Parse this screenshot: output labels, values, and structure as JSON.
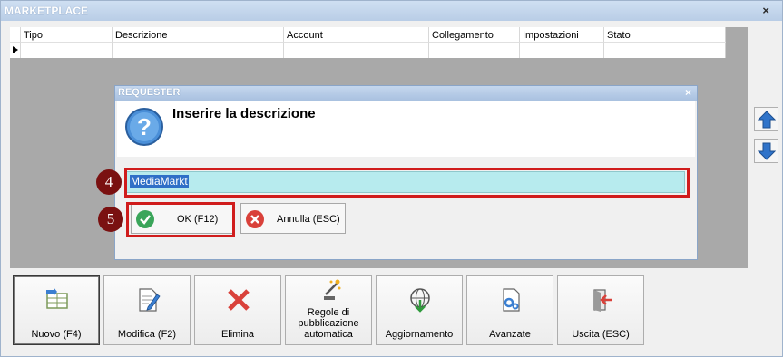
{
  "window": {
    "title": "MARKETPLACE",
    "close_glyph": "×"
  },
  "grid": {
    "columns": [
      "Tipo",
      "Descrizione",
      "Account",
      "Collegamento",
      "Impostazioni",
      "Stato"
    ]
  },
  "dialog": {
    "title": "REQUESTER",
    "close_glyph": "×",
    "message": "Inserire la descrizione",
    "input_value": "MediaMarkt",
    "ok_label": "OK (F12)",
    "cancel_label": "Annulla (ESC)"
  },
  "markers": {
    "input": "4",
    "ok": "5"
  },
  "toolbar": {
    "new_label": "Nuovo (F4)",
    "edit_label": "Modifica (F2)",
    "delete_label": "Elimina",
    "rules_label": "Regole di pubblicazione automatica",
    "update_label": "Aggiornamento",
    "advanced_label": "Avanzate",
    "exit_label": "Uscita (ESC)"
  },
  "icons": {
    "up": "arrow-up-icon",
    "down": "arrow-down-icon",
    "question": "question-icon",
    "check": "check-icon",
    "cancel": "cancel-icon"
  },
  "colors": {
    "highlight": "#d01c1c",
    "marker": "#7a1111",
    "input_bg": "#b7ebee",
    "selection": "#2f6fc7"
  }
}
